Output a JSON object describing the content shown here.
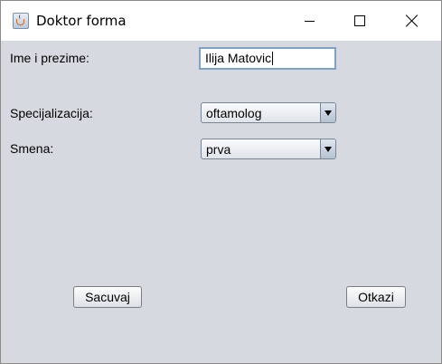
{
  "window": {
    "title": "Doktor forma",
    "icon": "java-cup-icon",
    "controls": [
      "minimize-icon",
      "maximize-icon",
      "close-icon"
    ]
  },
  "form": {
    "name_label": "Ime i prezime:",
    "name_value": "Ilija Matovic",
    "specialization_label": "Specijalizacija:",
    "specialization_value": "oftamolog",
    "shift_label": "Smena:",
    "shift_value": "prva"
  },
  "buttons": {
    "save_label": "Sacuvaj",
    "cancel_label": "Otkazi"
  },
  "colors": {
    "content_background": "#d6d9df",
    "input_focus_border": "#7fa3c7"
  }
}
